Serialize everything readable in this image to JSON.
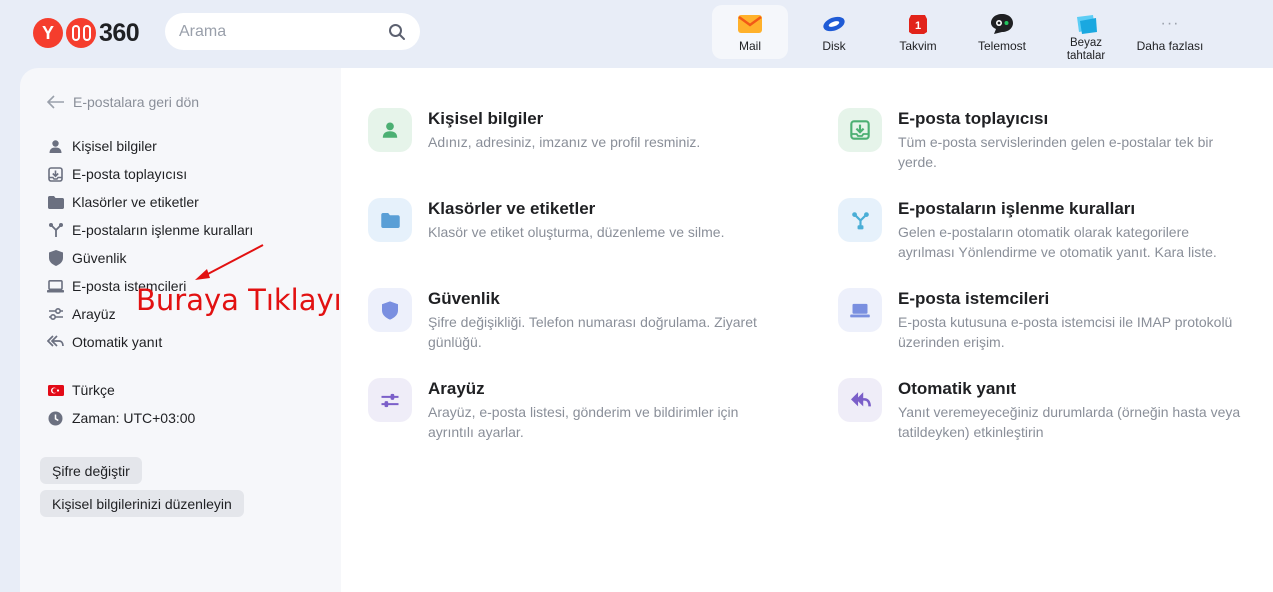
{
  "header": {
    "logo_text": "360",
    "search_placeholder": "Arama",
    "apps": [
      {
        "label": "Mail",
        "icon": "mail-icon"
      },
      {
        "label": "Disk",
        "icon": "disk-icon"
      },
      {
        "label": "Takvim",
        "icon": "calendar-icon",
        "badge": "1"
      },
      {
        "label": "Telemost",
        "icon": "telemost-icon"
      },
      {
        "label_line1": "Beyaz",
        "label_line2": "tahtalar",
        "icon": "whiteboard-icon"
      },
      {
        "label": "Daha fazlası",
        "icon": "more-icon",
        "glyph": "···"
      }
    ]
  },
  "sidebar": {
    "back_label": "E-postalara geri dön",
    "items": [
      {
        "label": "Kişisel bilgiler",
        "icon": "person-icon"
      },
      {
        "label": "E-posta toplayıcısı",
        "icon": "inbox-download-icon"
      },
      {
        "label": "Klasörler ve etiketler",
        "icon": "folder-icon"
      },
      {
        "label": "E-postaların işlenme kuralları",
        "icon": "rules-icon"
      },
      {
        "label": "Güvenlik",
        "icon": "shield-icon"
      },
      {
        "label": "E-posta istemcileri",
        "icon": "laptop-icon"
      },
      {
        "label": "Arayüz",
        "icon": "sliders-icon"
      },
      {
        "label": "Otomatik yanıt",
        "icon": "reply-all-icon"
      }
    ],
    "language": "Türkçe",
    "timezone": "Zaman: UTC+03:00",
    "buttons": {
      "change_password": "Şifre değiştir",
      "edit_personal": "Kişisel bilgilerinizi düzenleyin"
    }
  },
  "annotation": "Buraya Tıklayın",
  "cards": [
    {
      "title": "Kişisel bilgiler",
      "desc": "Adınız, adresiniz, imzanız ve profil resminiz."
    },
    {
      "title": "E-posta toplayıcısı",
      "desc": "Tüm e-posta servislerinden gelen e-postalar tek bir yerde."
    },
    {
      "title": "Klasörler ve etiketler",
      "desc": "Klasör ve etiket oluşturma, düzenleme ve silme."
    },
    {
      "title": "E-postaların işlenme kuralları",
      "desc": "Gelen e-postaların otomatik olarak kategorilere ayrılması Yönlendirme ve otomatik yanıt. Kara liste."
    },
    {
      "title": "Güvenlik",
      "desc": "Şifre değişikliği. Telefon numarası doğrulama. Ziyaret günlüğü."
    },
    {
      "title": "E-posta istemcileri",
      "desc": "E-posta kutusuna e-posta istemcisi ile IMAP protokolü üzerinden erişim."
    },
    {
      "title": "Arayüz",
      "desc": "Arayüz, e-posta listesi, gönderim ve bildirimler için ayrıntılı ayarlar."
    },
    {
      "title": "Otomatik yanıt",
      "desc": "Yanıt veremeyeceğiniz durumlarda (örneğin hasta veya tatildeyken) etkinleştirin"
    }
  ],
  "colors": {
    "accent_red": "#f53d2d",
    "annotation_red": "#e21111",
    "icon_green": "#4caf73",
    "icon_blue": "#5a9fd6",
    "icon_violet": "#7a8fe0",
    "icon_purple": "#7b5fc9"
  }
}
